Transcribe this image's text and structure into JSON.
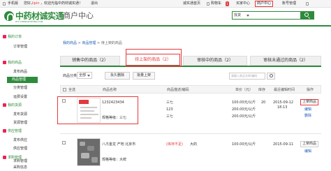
{
  "topbar": {
    "mobile": "手机版",
    "welcome_prefix": "您好，",
    "username": "lipin",
    "welcome_text": "，欢迎光临中药材诚实通！",
    "logout": "退出",
    "links": [
      "诚实通首页",
      "购物车",
      "买家中心",
      "商户中心",
      "账号管理"
    ],
    "cart_count": "1"
  },
  "header": {
    "logo_text": "中药材诚实通",
    "logo_sub": "ZYC.CHENGSHITONG.COM",
    "section_title": "商户中心",
    "search_scope": "找货",
    "search_placeholder": ""
  },
  "sidebar": {
    "groups": [
      {
        "title": "我的订单",
        "items": [
          "订单管理"
        ]
      },
      {
        "title": "我的商品",
        "items": [
          "发布商品",
          "商品管理",
          "分类管理",
          "运费设置"
        ]
      },
      {
        "title": "我的货源",
        "items": [
          "发布货源",
          "货源管理"
        ]
      },
      {
        "title": "供应管理",
        "items": [
          "发布供应",
          "供应管理"
        ]
      },
      {
        "title": "求购管理",
        "items": [
          "求购管理",
          "采购信息"
        ]
      }
    ]
  },
  "breadcrumb": {
    "parts": [
      "我的商品",
      "商品管理",
      "待上架的商品"
    ],
    "sep": ">"
  },
  "tabs": [
    {
      "label": "销售中的商品（2）"
    },
    {
      "label": "待上架的商品（2）"
    },
    {
      "label": "审核中的商品（2）"
    },
    {
      "label": "审核未通过的商品（2）"
    }
  ],
  "filter": {
    "label": "商品分类",
    "category": "全部",
    "btn_permanent": "永久删除",
    "btn_batch_publish": "批量上架",
    "kw_placeholder": "请输入商品名称/编码"
  },
  "table": {
    "headers": [
      "全选",
      "商品名称",
      "商品描述/编码",
      "单价（元）",
      "库存",
      "最近编辑时间",
      "操作"
    ],
    "rows": [
      {
        "name": "1232423434",
        "spec": "规格等级：三七",
        "desc": "三七",
        "code": "123",
        "price": "100.00元/公斤",
        "price2": "200.00元/公斤",
        "price3": "200.00元/公斤",
        "stock": "20",
        "time": "2015-09-12",
        "time2": "18:13",
        "op1": "上架商品",
        "op2": "编辑",
        "op3": "删除"
      },
      {
        "name": "八爪金龙 产地 北京市",
        "spec": "规格等级：大统",
        "desc": "(库存不足)",
        "desc2": "大的",
        "price": "100.00元/公斤",
        "stock": "",
        "time": "2015-09-11",
        "op1": "上架商品",
        "op2": "编辑"
      }
    ]
  },
  "colors": {
    "brand": "#2e8b3d",
    "highlight": "#e4393c",
    "link": "#1a5fb4"
  }
}
